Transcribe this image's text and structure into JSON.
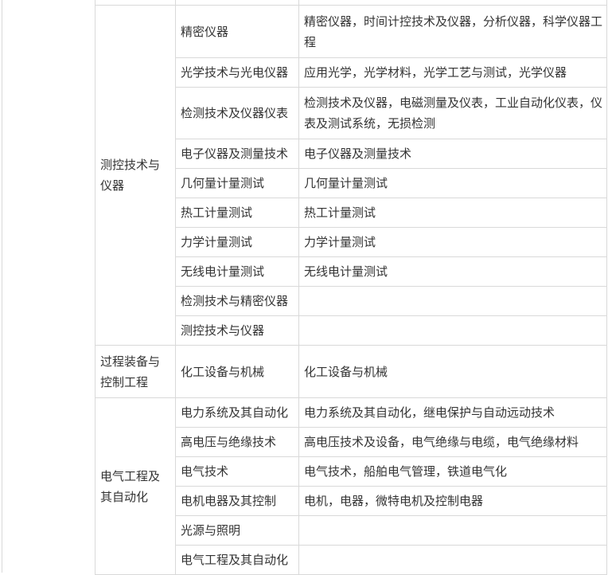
{
  "groups": [
    {
      "category": "测控技术与仪器",
      "rows": [
        {
          "major": "精密仪器",
          "old": "精密仪器，时间计控技术及仪器，分析仪器，科学仪器工程"
        },
        {
          "major": "光学技术与光电仪器",
          "old": "应用光学，光学材料，光学工艺与测试，光学仪器"
        },
        {
          "major": "检测技术及仪器仪表",
          "old": "检测技术及仪器，电磁测量及仪表，工业自动化仪表，仪表及测试系统，无损检测"
        },
        {
          "major": "电子仪器及测量技术",
          "old": "电子仪器及测量技术"
        },
        {
          "major": "几何量计量测试",
          "old": "几何量计量测试"
        },
        {
          "major": "热工计量测试",
          "old": "热工计量测试"
        },
        {
          "major": "力学计量测试",
          "old": "力学计量测试"
        },
        {
          "major": "无线电计量测试",
          "old": "无线电计量测试"
        },
        {
          "major": "检测技术与精密仪器",
          "old": ""
        },
        {
          "major": "测控技术与仪器",
          "old": ""
        }
      ]
    },
    {
      "category": "过程装备与控制工程",
      "rows": [
        {
          "major": "化工设备与机械",
          "old": "化工设备与机械"
        }
      ]
    },
    {
      "category": "电气工程及其自动化",
      "rows": [
        {
          "major": "电力系统及其自动化",
          "old": "电力系统及其自动化，继电保护与自动远动技术"
        },
        {
          "major": "高电压与绝缘技术",
          "old": "高电压技术及设备，电气绝缘与电缆，电气绝缘材料"
        },
        {
          "major": "电气技术",
          "old": "电气技术，船舶电气管理，铁道电气化"
        },
        {
          "major": "电机电器及其控制",
          "old": "电机，电器，微特电机及控制电器"
        },
        {
          "major": "光源与照明",
          "old": ""
        },
        {
          "major": "电气工程及其自动化",
          "old": ""
        }
      ]
    }
  ]
}
